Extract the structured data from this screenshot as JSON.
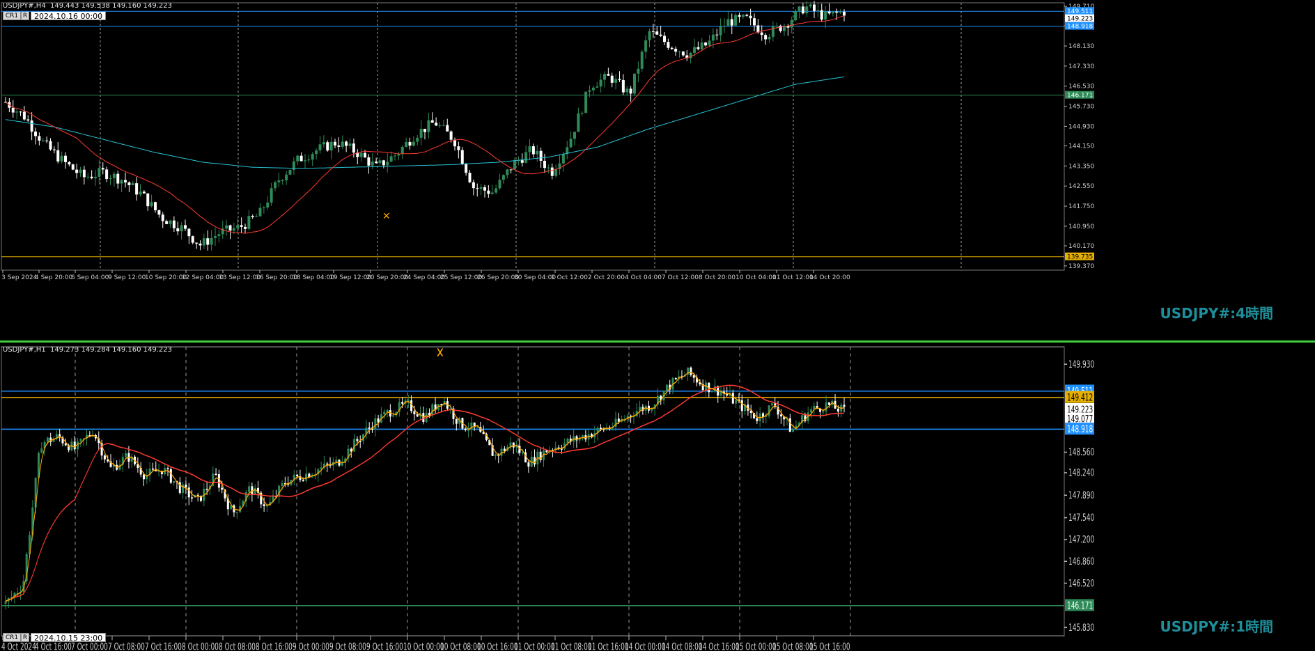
{
  "top_chart": {
    "header": "USDJPY#,H4  149.443 149.538 149.160 149.223",
    "button_cr": "CR1",
    "button_r": "R",
    "date_box": "2024.10.16 00:00",
    "watermark": "USDJPY#:4時間",
    "price_labels": [
      "149.710",
      "148.930",
      "148.130",
      "147.330",
      "146.530",
      "145.730",
      "144.930",
      "144.150",
      "143.350",
      "142.550",
      "141.750",
      "140.950",
      "140.170",
      "139.370"
    ],
    "marker_labels": [
      {
        "text": "149.511",
        "color": "#1e90ff"
      },
      {
        "text": "149.223",
        "color": "#ffffff"
      },
      {
        "text": "148.918",
        "color": "#1e90ff"
      },
      {
        "text": "146.171",
        "color": "#2e8b57"
      },
      {
        "text": "139.735",
        "color": "#e5b000"
      }
    ],
    "time_labels": [
      "3 Sep 2024",
      "4 Sep 20:00",
      "6 Sep 04:00",
      "9 Sep 12:00",
      "10 Sep 20:00",
      "12 Sep 04:00",
      "13 Sep 12:00",
      "16 Sep 20:00",
      "18 Sep 04:00",
      "19 Sep 12:00",
      "20 Sep 20:00",
      "24 Sep 04:00",
      "25 Sep 12:00",
      "26 Sep 20:00",
      "30 Sep 04:00",
      "1 Oct 12:00",
      "2 Oct 20:00",
      "4 Oct 04:00",
      "7 Oct 12:00",
      "8 Oct 20:00",
      "10 Oct 04:00",
      "11 Oct 12:00",
      "14 Oct 20:00"
    ]
  },
  "bottom_chart": {
    "header": "USDJPY#,H1  149.273 149.284 149.160 149.223",
    "button_cr": "CR1",
    "button_r": "R",
    "date_box": "2024.10.15 23:00",
    "watermark": "USDJPY#:1時間",
    "price_labels": [
      "149.930",
      "148.560",
      "148.240",
      "147.890",
      "147.540",
      "147.200",
      "146.860",
      "146.520",
      "145.830"
    ],
    "marker_labels": [
      {
        "text": "149.511",
        "color": "#1e90ff"
      },
      {
        "text": "149.412",
        "color": "#e5b000"
      },
      {
        "text": "149.223",
        "color": "#ffffff"
      },
      {
        "text": "149.077",
        "color": "#ffffff"
      },
      {
        "text": "148.918",
        "color": "#1e90ff"
      },
      {
        "text": "146.171",
        "color": "#2e8b57"
      }
    ],
    "time_labels": [
      "4 Oct 2024",
      "4 Oct 16:00",
      "7 Oct 00:00",
      "7 Oct 08:00",
      "7 Oct 16:00",
      "8 Oct 00:00",
      "8 Oct 08:00",
      "8 Oct 16:00",
      "9 Oct 00:00",
      "9 Oct 08:00",
      "9 Oct 16:00",
      "10 Oct 00:00",
      "10 Oct 08:00",
      "10 Oct 16:00",
      "11 Oct 00:00",
      "11 Oct 08:00",
      "11 Oct 16:00",
      "14 Oct 00:00",
      "14 Oct 08:00",
      "14 Oct 16:00",
      "15 Oct 00:00",
      "15 Oct 08:00",
      "15 Oct 16:00"
    ]
  },
  "colors": {
    "bull_candle": "#2e8b57",
    "bear_candle": "#ffffff",
    "ma_fast": "#ff3b30",
    "ma_slow": "#27c4d6",
    "zigzag": "#ffa500",
    "level_blue": "#1e90ff",
    "level_yellow": "#e5b000",
    "level_green": "#2e8b57",
    "grid": "#9a9a9a"
  }
}
